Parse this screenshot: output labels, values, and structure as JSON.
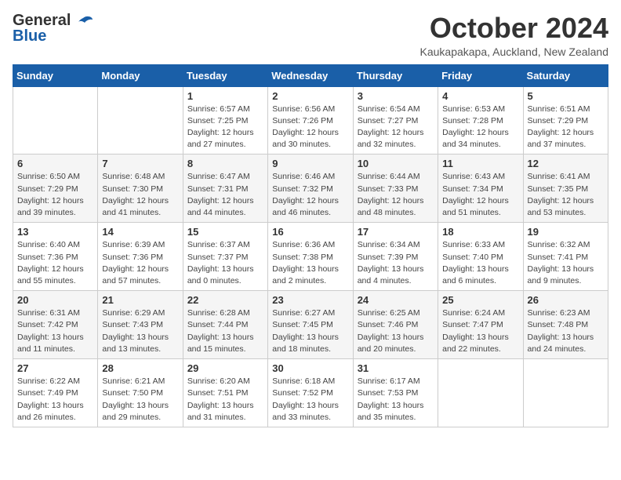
{
  "header": {
    "logo_general": "General",
    "logo_blue": "Blue",
    "title": "October 2024",
    "subtitle": "Kaukapakapa, Auckland, New Zealand"
  },
  "days_of_week": [
    "Sunday",
    "Monday",
    "Tuesday",
    "Wednesday",
    "Thursday",
    "Friday",
    "Saturday"
  ],
  "weeks": [
    [
      {
        "day": "",
        "info": ""
      },
      {
        "day": "",
        "info": ""
      },
      {
        "day": "1",
        "info": "Sunrise: 6:57 AM\nSunset: 7:25 PM\nDaylight: 12 hours\nand 27 minutes."
      },
      {
        "day": "2",
        "info": "Sunrise: 6:56 AM\nSunset: 7:26 PM\nDaylight: 12 hours\nand 30 minutes."
      },
      {
        "day": "3",
        "info": "Sunrise: 6:54 AM\nSunset: 7:27 PM\nDaylight: 12 hours\nand 32 minutes."
      },
      {
        "day": "4",
        "info": "Sunrise: 6:53 AM\nSunset: 7:28 PM\nDaylight: 12 hours\nand 34 minutes."
      },
      {
        "day": "5",
        "info": "Sunrise: 6:51 AM\nSunset: 7:29 PM\nDaylight: 12 hours\nand 37 minutes."
      }
    ],
    [
      {
        "day": "6",
        "info": "Sunrise: 6:50 AM\nSunset: 7:29 PM\nDaylight: 12 hours\nand 39 minutes."
      },
      {
        "day": "7",
        "info": "Sunrise: 6:48 AM\nSunset: 7:30 PM\nDaylight: 12 hours\nand 41 minutes."
      },
      {
        "day": "8",
        "info": "Sunrise: 6:47 AM\nSunset: 7:31 PM\nDaylight: 12 hours\nand 44 minutes."
      },
      {
        "day": "9",
        "info": "Sunrise: 6:46 AM\nSunset: 7:32 PM\nDaylight: 12 hours\nand 46 minutes."
      },
      {
        "day": "10",
        "info": "Sunrise: 6:44 AM\nSunset: 7:33 PM\nDaylight: 12 hours\nand 48 minutes."
      },
      {
        "day": "11",
        "info": "Sunrise: 6:43 AM\nSunset: 7:34 PM\nDaylight: 12 hours\nand 51 minutes."
      },
      {
        "day": "12",
        "info": "Sunrise: 6:41 AM\nSunset: 7:35 PM\nDaylight: 12 hours\nand 53 minutes."
      }
    ],
    [
      {
        "day": "13",
        "info": "Sunrise: 6:40 AM\nSunset: 7:36 PM\nDaylight: 12 hours\nand 55 minutes."
      },
      {
        "day": "14",
        "info": "Sunrise: 6:39 AM\nSunset: 7:36 PM\nDaylight: 12 hours\nand 57 minutes."
      },
      {
        "day": "15",
        "info": "Sunrise: 6:37 AM\nSunset: 7:37 PM\nDaylight: 13 hours\nand 0 minutes."
      },
      {
        "day": "16",
        "info": "Sunrise: 6:36 AM\nSunset: 7:38 PM\nDaylight: 13 hours\nand 2 minutes."
      },
      {
        "day": "17",
        "info": "Sunrise: 6:34 AM\nSunset: 7:39 PM\nDaylight: 13 hours\nand 4 minutes."
      },
      {
        "day": "18",
        "info": "Sunrise: 6:33 AM\nSunset: 7:40 PM\nDaylight: 13 hours\nand 6 minutes."
      },
      {
        "day": "19",
        "info": "Sunrise: 6:32 AM\nSunset: 7:41 PM\nDaylight: 13 hours\nand 9 minutes."
      }
    ],
    [
      {
        "day": "20",
        "info": "Sunrise: 6:31 AM\nSunset: 7:42 PM\nDaylight: 13 hours\nand 11 minutes."
      },
      {
        "day": "21",
        "info": "Sunrise: 6:29 AM\nSunset: 7:43 PM\nDaylight: 13 hours\nand 13 minutes."
      },
      {
        "day": "22",
        "info": "Sunrise: 6:28 AM\nSunset: 7:44 PM\nDaylight: 13 hours\nand 15 minutes."
      },
      {
        "day": "23",
        "info": "Sunrise: 6:27 AM\nSunset: 7:45 PM\nDaylight: 13 hours\nand 18 minutes."
      },
      {
        "day": "24",
        "info": "Sunrise: 6:25 AM\nSunset: 7:46 PM\nDaylight: 13 hours\nand 20 minutes."
      },
      {
        "day": "25",
        "info": "Sunrise: 6:24 AM\nSunset: 7:47 PM\nDaylight: 13 hours\nand 22 minutes."
      },
      {
        "day": "26",
        "info": "Sunrise: 6:23 AM\nSunset: 7:48 PM\nDaylight: 13 hours\nand 24 minutes."
      }
    ],
    [
      {
        "day": "27",
        "info": "Sunrise: 6:22 AM\nSunset: 7:49 PM\nDaylight: 13 hours\nand 26 minutes."
      },
      {
        "day": "28",
        "info": "Sunrise: 6:21 AM\nSunset: 7:50 PM\nDaylight: 13 hours\nand 29 minutes."
      },
      {
        "day": "29",
        "info": "Sunrise: 6:20 AM\nSunset: 7:51 PM\nDaylight: 13 hours\nand 31 minutes."
      },
      {
        "day": "30",
        "info": "Sunrise: 6:18 AM\nSunset: 7:52 PM\nDaylight: 13 hours\nand 33 minutes."
      },
      {
        "day": "31",
        "info": "Sunrise: 6:17 AM\nSunset: 7:53 PM\nDaylight: 13 hours\nand 35 minutes."
      },
      {
        "day": "",
        "info": ""
      },
      {
        "day": "",
        "info": ""
      }
    ]
  ]
}
